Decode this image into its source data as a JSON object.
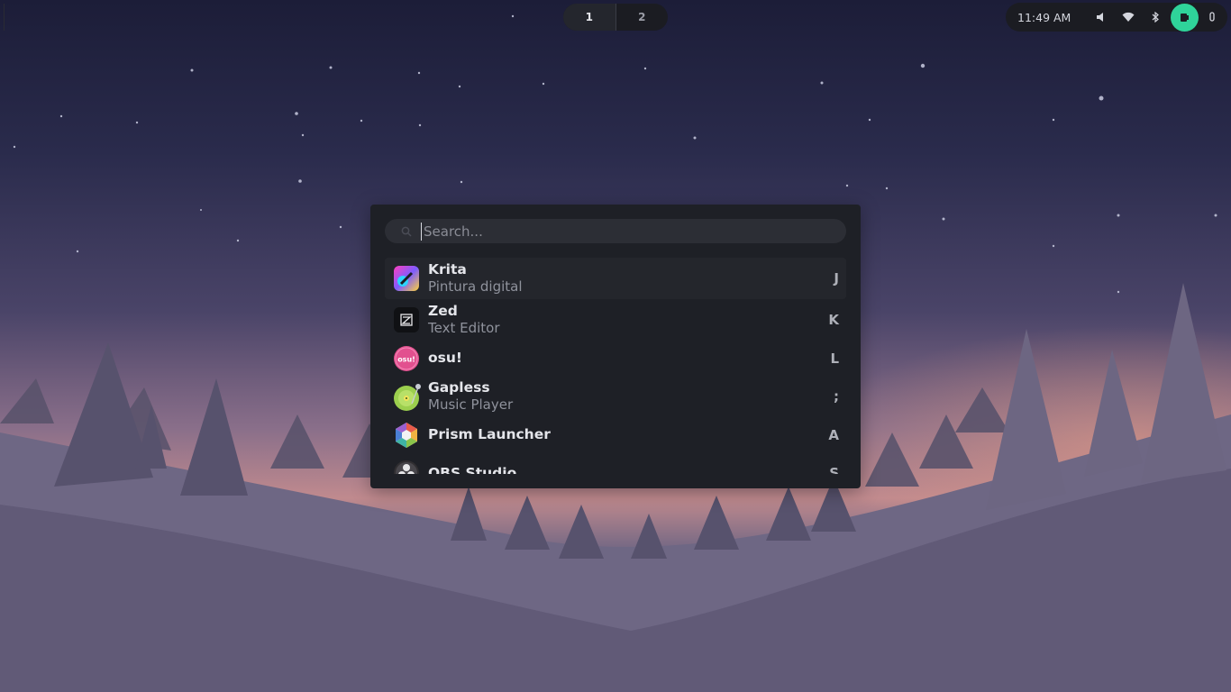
{
  "topbar": {
    "workspaces": [
      {
        "label": "1",
        "active": true
      },
      {
        "label": "2",
        "active": false
      }
    ],
    "clock": "11:49 AM",
    "tray_icons": [
      "volume-icon",
      "wifi-icon",
      "bluetooth-icon",
      "battery-icon",
      "microphone-icon"
    ],
    "battery_color": "#2fd39a"
  },
  "launcher": {
    "search_placeholder": "Search...",
    "items": [
      {
        "title": "Krita",
        "subtitle": "Pintura digital",
        "key": "J",
        "icon": "krita-icon"
      },
      {
        "title": "Zed",
        "subtitle": "Text Editor",
        "key": "K",
        "icon": "zed-icon"
      },
      {
        "title": "osu!",
        "subtitle": "",
        "key": "L",
        "icon": "osu-icon",
        "icon_text": "osu!"
      },
      {
        "title": "Gapless",
        "subtitle": "Music Player",
        "key": ";",
        "icon": "gapless-icon"
      },
      {
        "title": "Prism Launcher",
        "subtitle": "",
        "key": "A",
        "icon": "prism-launcher-icon"
      },
      {
        "title": "OBS Studio",
        "subtitle": "",
        "key": "S",
        "icon": "obs-studio-icon"
      }
    ]
  }
}
